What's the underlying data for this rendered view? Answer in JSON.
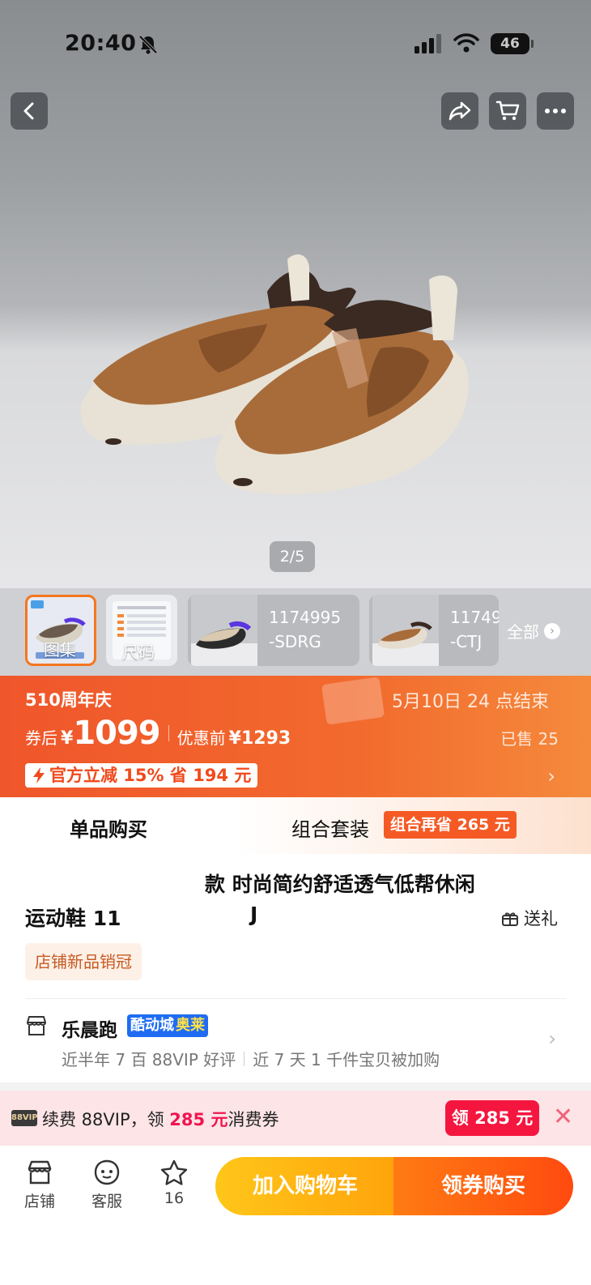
{
  "status_bar": {
    "time": "20:40",
    "network": "46"
  },
  "gallery": {
    "page_indicator": "2/5"
  },
  "thumbnails": [
    {
      "label": "图集"
    },
    {
      "label": "尺码"
    },
    {
      "code_line1": "1174995",
      "code_line2": "-SDRG"
    },
    {
      "code_line1": "11749",
      "code_line2": "-CTJ"
    }
  ],
  "thumbnails_all": "全部",
  "promo": {
    "event": "510周年庆",
    "ends": "5月10日 24 点结束",
    "after_coupon_label": "券后",
    "currency": "¥",
    "after_coupon_price": "1099",
    "before_label": "优惠前",
    "before_price": "¥1293",
    "sold": "已售 25",
    "official_discount": "官方立减 15% 省 194 元"
  },
  "tabs": {
    "single": "单品购买",
    "bundle": "组合套装",
    "bundle_badge": "组合再省 265 元"
  },
  "product": {
    "title_line1": "款 时尚简约舒适透气低帮休闲",
    "title_line2a": "运动鞋 11",
    "title_line2b": "J",
    "gift_label": "送礼",
    "shop_badge": "店铺新品销冠"
  },
  "shop": {
    "name": "乐晨跑",
    "tag_a": "酷动城",
    "tag_b": "奥莱",
    "stat1": "近半年 7 百 88VIP 好评",
    "stat2": "近 7 天 1 千件宝贝被加购"
  },
  "vip": {
    "logo": "88VIP",
    "text_prefix": "续费 88VIP，领 ",
    "amount": "285 元",
    "text_suffix": "消费券",
    "claim": "领 285 元"
  },
  "bottom_nav": {
    "shop": "店铺",
    "service": "客服",
    "fav_count": "16",
    "add_cart": "加入购物车",
    "buy": "领券购买"
  }
}
